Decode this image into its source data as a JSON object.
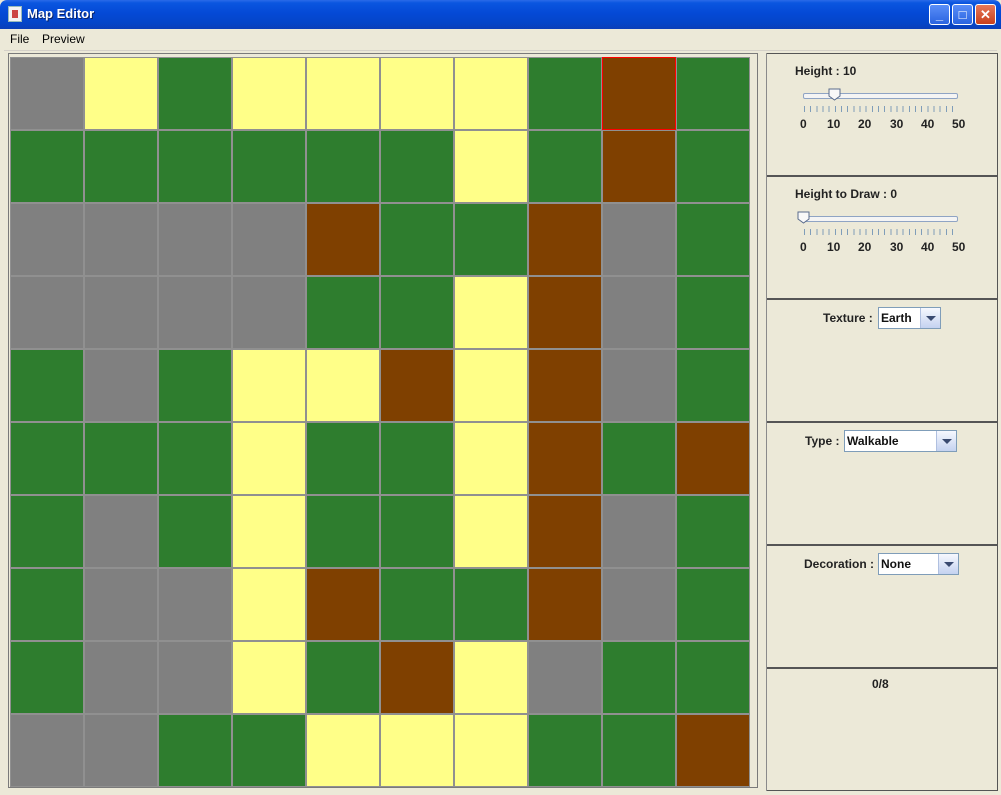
{
  "window": {
    "title": "Map Editor",
    "controls": {
      "minimize": "_",
      "maximize": "□",
      "close": "✕"
    }
  },
  "menu": {
    "items": [
      "File",
      "Preview"
    ]
  },
  "colors": {
    "grass": "#2e7d2e",
    "sand": "#ffff88",
    "earth": "#7f4000",
    "stone": "#808080",
    "selection": "#ff0000"
  },
  "map": {
    "rows": 10,
    "cols": 10,
    "selected": {
      "row": 0,
      "col": 8
    },
    "tiles": [
      [
        "stone",
        "sand",
        "grass",
        "sand",
        "sand",
        "sand",
        "sand",
        "grass",
        "earth",
        "grass"
      ],
      [
        "grass",
        "grass",
        "grass",
        "grass",
        "grass",
        "grass",
        "sand",
        "grass",
        "earth",
        "grass"
      ],
      [
        "stone",
        "stone",
        "stone",
        "stone",
        "earth",
        "grass",
        "grass",
        "earth",
        "stone",
        "grass"
      ],
      [
        "stone",
        "stone",
        "stone",
        "stone",
        "grass",
        "grass",
        "sand",
        "earth",
        "stone",
        "grass"
      ],
      [
        "grass",
        "stone",
        "grass",
        "sand",
        "sand",
        "earth",
        "sand",
        "earth",
        "stone",
        "grass"
      ],
      [
        "grass",
        "grass",
        "grass",
        "sand",
        "grass",
        "grass",
        "sand",
        "earth",
        "grass",
        "earth"
      ],
      [
        "grass",
        "stone",
        "grass",
        "sand",
        "grass",
        "grass",
        "sand",
        "earth",
        "stone",
        "grass"
      ],
      [
        "grass",
        "stone",
        "stone",
        "sand",
        "earth",
        "grass",
        "grass",
        "earth",
        "stone",
        "grass"
      ],
      [
        "grass",
        "stone",
        "stone",
        "sand",
        "grass",
        "earth",
        "sand",
        "stone",
        "grass",
        "grass"
      ],
      [
        "stone",
        "stone",
        "grass",
        "grass",
        "sand",
        "sand",
        "sand",
        "grass",
        "grass",
        "earth"
      ]
    ]
  },
  "panels": {
    "height": {
      "label": "Height : 10",
      "value": 10,
      "min": 0,
      "max": 50,
      "ticks": [
        "0",
        "10",
        "20",
        "30",
        "40",
        "50"
      ]
    },
    "height_to_draw": {
      "label": "Height to Draw : 0",
      "value": 0,
      "min": 0,
      "max": 50,
      "ticks": [
        "0",
        "10",
        "20",
        "30",
        "40",
        "50"
      ]
    },
    "texture": {
      "label": "Texture :",
      "value": "Earth"
    },
    "type": {
      "label": "Type :",
      "value": "Walkable"
    },
    "decoration": {
      "label": "Decoration :",
      "value": "None"
    },
    "counter": "0/8"
  }
}
